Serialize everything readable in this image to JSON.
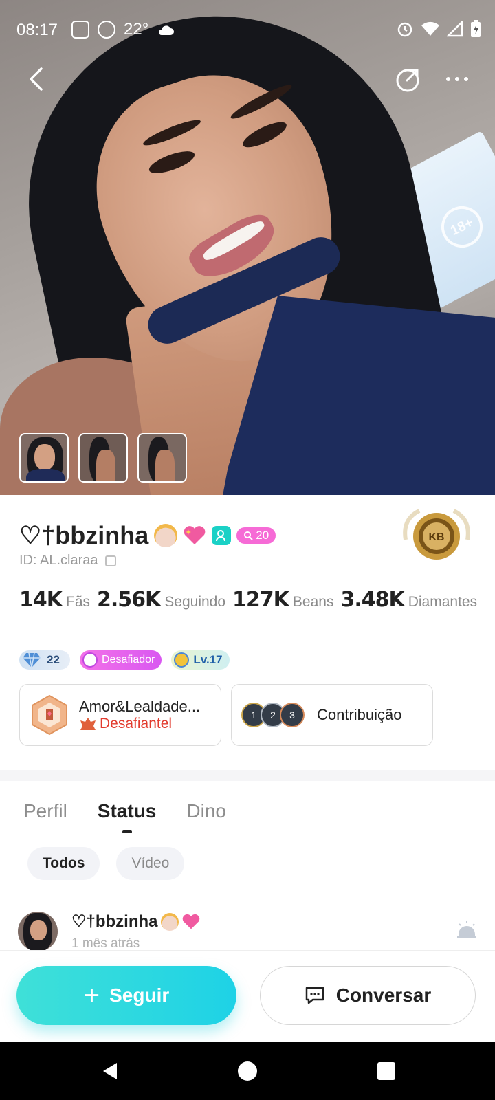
{
  "status_bar": {
    "time": "08:17",
    "temp": "22°",
    "icons_left": [
      "app-notification-icon",
      "whatsapp-icon",
      "cloud-icon"
    ],
    "icons_right": [
      "alarm-icon",
      "wifi-icon",
      "signal-icon",
      "battery-charging-icon"
    ]
  },
  "header": {
    "back_icon": "chevron-left-icon",
    "share_icon": "share-icon",
    "more_icon": "more-horizontal-icon"
  },
  "hero": {
    "tv_badge": "18+"
  },
  "photos": [
    "photo-1",
    "photo-2",
    "photo-3"
  ],
  "profile": {
    "name": "♡†bbzinha",
    "emojis": [
      "princess-emoji",
      "sparkling-heart-emoji"
    ],
    "level_badge": "20",
    "id_label": "ID: AL.claraa",
    "medal": "gold-medal-badge"
  },
  "stats": [
    {
      "value": "14K",
      "label": "Fãs"
    },
    {
      "value": "2.56K",
      "label": "Seguindo"
    },
    {
      "value": "127K",
      "label": "Beans"
    },
    {
      "value": "3.48K",
      "label": "Diamantes"
    }
  ],
  "badges": {
    "diamond": "22",
    "challenger": "Desafiador",
    "level": "Lv.17"
  },
  "cards": {
    "family_name": "Amor&Lealdade...",
    "family_sub": "Desafiantel",
    "contribution": "Contribuição",
    "ranks": [
      "1",
      "2",
      "3"
    ]
  },
  "tabs": [
    {
      "label": "Perfil",
      "active": false
    },
    {
      "label": "Status",
      "active": true
    },
    {
      "label": "Dino",
      "active": false
    }
  ],
  "chips": [
    {
      "label": "Todos",
      "active": true
    },
    {
      "label": "Vídeo",
      "active": false
    }
  ],
  "post": {
    "author": "♡†bbzinha",
    "time": "1 mês atrás"
  },
  "actions": {
    "follow": "Seguir",
    "chat": "Conversar"
  },
  "colors": {
    "accent": "#1ed2e6",
    "challenger_pink": "#f372e8",
    "family_red": "#e23b2e"
  }
}
